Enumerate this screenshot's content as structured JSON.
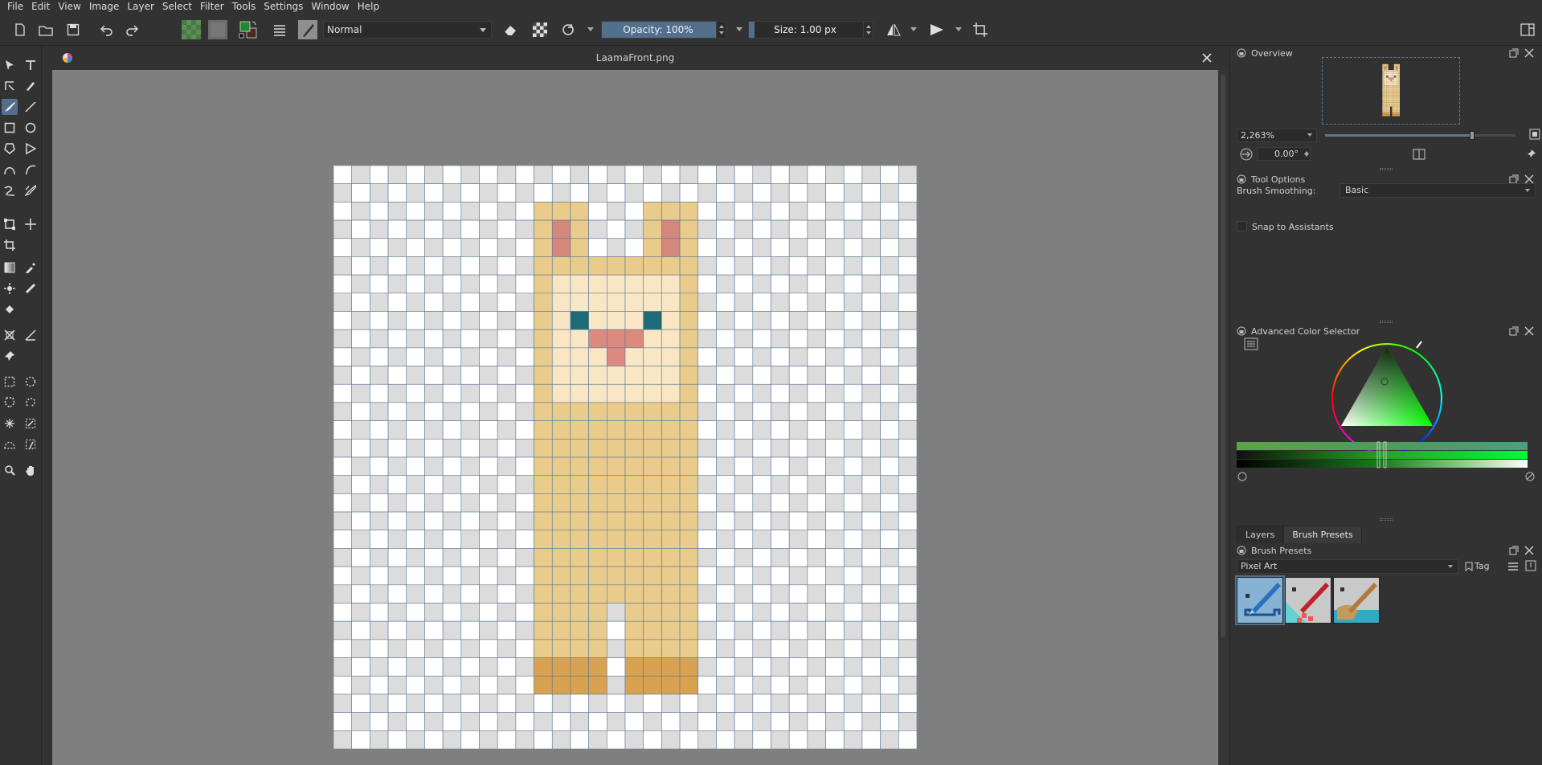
{
  "menu": [
    "File",
    "Edit",
    "View",
    "Image",
    "Layer",
    "Select",
    "Filter",
    "Tools",
    "Settings",
    "Window",
    "Help"
  ],
  "toolbar": {
    "blend_mode": "Normal",
    "opacity_label": "Opacity: 100%",
    "opacity_value": 1.0,
    "size_label": "Size: 1.00 px",
    "size_fill": 0.05
  },
  "document": {
    "title": "LaamaFront.png"
  },
  "overview": {
    "title": "Overview",
    "zoom": "2,263%",
    "zoom_slider": 0.76,
    "rotation": "0.00°"
  },
  "tool_options": {
    "title": "Tool Options",
    "smoothing_label": "Brush Smoothing:",
    "smoothing_value": "Basic",
    "snap_label": "Snap to Assistants",
    "snap_checked": false
  },
  "color_selector": {
    "title": "Advanced Color Selector",
    "current_color": "#00c800"
  },
  "tabs": [
    "Layers",
    "Brush Presets"
  ],
  "active_tab": "Brush Presets",
  "brush_presets": {
    "title": "Brush Presets",
    "tag": "Pixel Art",
    "tag_button": "Tag",
    "presets": [
      "pixel-pen-blue",
      "pixel-pen-red",
      "pixel-pen-brown"
    ]
  },
  "icons": {
    "app": "krita-icon",
    "close": "close-icon"
  },
  "colors": {
    "accent": "#52708e",
    "llama_body": "#e9cb8c",
    "llama_face": "#f9e6c5",
    "llama_ear": "#d4877c",
    "llama_eye": "#1f6b78",
    "llama_mouth": "#dc8a80",
    "llama_feet": "#d9a251"
  }
}
